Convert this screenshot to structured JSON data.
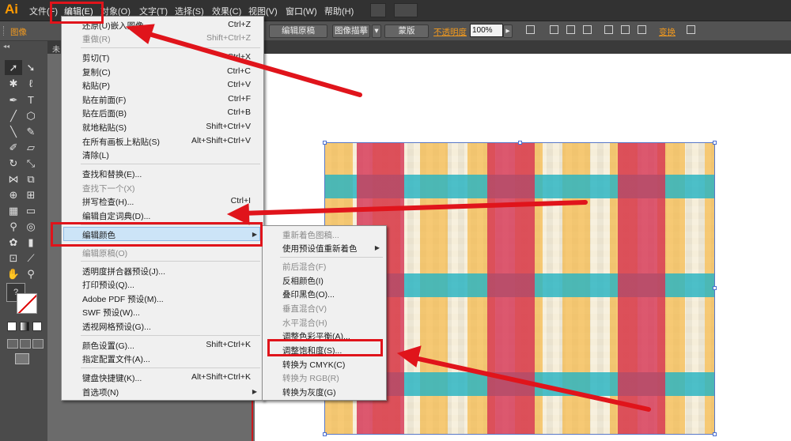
{
  "app": {
    "logo": "Ai"
  },
  "menubar": {
    "items": [
      "文件(F)",
      "编辑(E)",
      "对象(O)",
      "文字(T)",
      "选择(S)",
      "效果(C)",
      "视图(V)",
      "窗口(W)",
      "帮助(H)"
    ]
  },
  "control_bar": {
    "object_label": "图像",
    "edit_original": "编辑原稿",
    "image_trace": "图像描摹",
    "mask": "蒙版",
    "opacity_label": "不透明度",
    "opacity_value": "100%",
    "transform": "变换"
  },
  "document_tab": {
    "label": "未"
  },
  "edit_menu": {
    "items": [
      {
        "label": "还原(U)嵌入图像",
        "shortcut": "Ctrl+Z",
        "disabled": false
      },
      {
        "label": "重做(R)",
        "shortcut": "Shift+Ctrl+Z",
        "disabled": true
      },
      {
        "label": "剪切(T)",
        "shortcut": "Ctrl+X",
        "disabled": false
      },
      {
        "label": "复制(C)",
        "shortcut": "Ctrl+C",
        "disabled": false
      },
      {
        "label": "粘贴(P)",
        "shortcut": "Ctrl+V",
        "disabled": false
      },
      {
        "label": "贴在前面(F)",
        "shortcut": "Ctrl+F",
        "disabled": false
      },
      {
        "label": "贴在后面(B)",
        "shortcut": "Ctrl+B",
        "disabled": false
      },
      {
        "label": "就地粘贴(S)",
        "shortcut": "Shift+Ctrl+V",
        "disabled": false
      },
      {
        "label": "在所有画板上粘贴(S)",
        "shortcut": "Alt+Shift+Ctrl+V",
        "disabled": false
      },
      {
        "label": "清除(L)",
        "shortcut": "",
        "disabled": false
      },
      {
        "label": "查找和替换(E)...",
        "shortcut": "",
        "disabled": false
      },
      {
        "label": "查找下一个(X)",
        "shortcut": "",
        "disabled": true
      },
      {
        "label": "拼写检查(H)...",
        "shortcut": "Ctrl+I",
        "disabled": false
      },
      {
        "label": "编辑自定词典(D)...",
        "shortcut": "",
        "disabled": false
      },
      {
        "label": "编辑颜色",
        "shortcut": "",
        "disabled": false
      },
      {
        "label": "编辑原稿(O)",
        "shortcut": "",
        "disabled": true
      },
      {
        "label": "透明度拼合器预设(J)...",
        "shortcut": "",
        "disabled": false
      },
      {
        "label": "打印预设(Q)...",
        "shortcut": "",
        "disabled": false
      },
      {
        "label": "Adobe PDF 预设(M)...",
        "shortcut": "",
        "disabled": false
      },
      {
        "label": "SWF 预设(W)...",
        "shortcut": "",
        "disabled": false
      },
      {
        "label": "透视网格预设(G)...",
        "shortcut": "",
        "disabled": false
      },
      {
        "label": "颜色设置(G)...",
        "shortcut": "Shift+Ctrl+K",
        "disabled": false
      },
      {
        "label": "指定配置文件(A)...",
        "shortcut": "",
        "disabled": false
      },
      {
        "label": "键盘快捷键(K)...",
        "shortcut": "Alt+Shift+Ctrl+K",
        "disabled": false
      },
      {
        "label": "首选项(N)",
        "shortcut": "",
        "disabled": false
      }
    ]
  },
  "color_submenu": {
    "items": [
      {
        "label": "重新着色图稿...",
        "disabled": true
      },
      {
        "label": "使用预设值重新着色",
        "disabled": false
      },
      {
        "label": "前后混合(F)",
        "disabled": true
      },
      {
        "label": "反相颜色(I)",
        "disabled": false
      },
      {
        "label": "叠印黑色(O)...",
        "disabled": false
      },
      {
        "label": "垂直混合(V)",
        "disabled": true
      },
      {
        "label": "水平混合(H)",
        "disabled": true
      },
      {
        "label": "调整色彩平衡(A)...",
        "disabled": false
      },
      {
        "label": "调整饱和度(S)...",
        "disabled": false
      },
      {
        "label": "转换为 CMYK(C)",
        "disabled": false
      },
      {
        "label": "转换为 RGB(R)",
        "disabled": true
      },
      {
        "label": "转换为灰度(G)",
        "disabled": false
      }
    ]
  },
  "tools": {
    "help_glyph": "?"
  },
  "colors": {
    "annotation_red": "#e0141b",
    "menu_bg": "#f0f0f0",
    "highlight": "#cce4f7",
    "app_orange": "#ff9a00"
  }
}
